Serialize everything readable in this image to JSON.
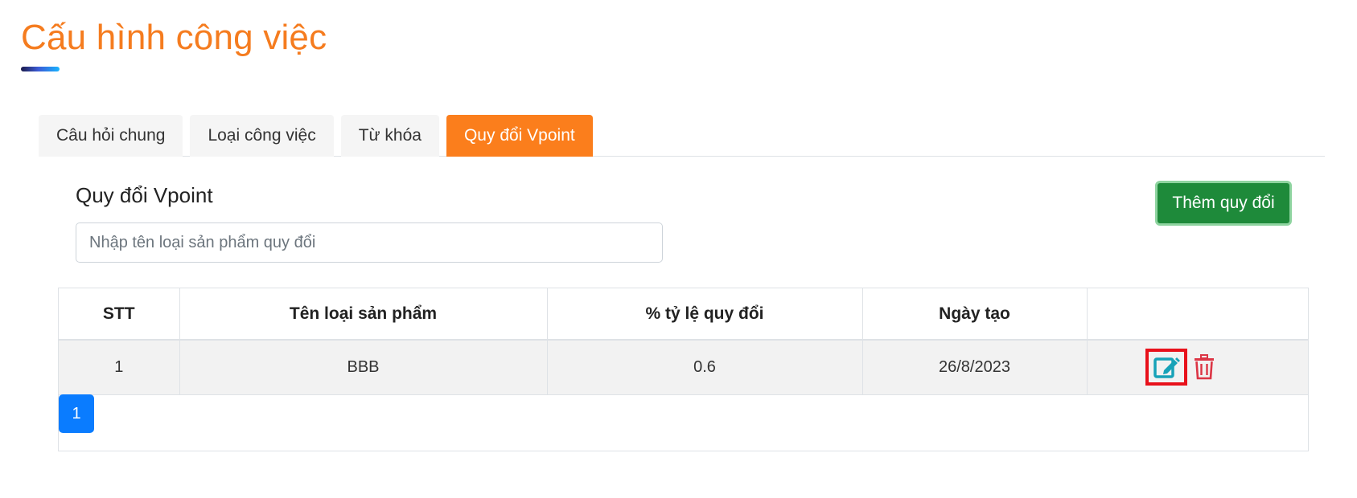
{
  "page": {
    "title": "Cấu hình công việc"
  },
  "tabs": [
    {
      "label": "Câu hỏi chung",
      "active": false
    },
    {
      "label": "Loại công việc",
      "active": false
    },
    {
      "label": "Từ khóa",
      "active": false
    },
    {
      "label": "Quy đổi Vpoint",
      "active": true
    }
  ],
  "section": {
    "title": "Quy đổi Vpoint",
    "add_button": "Thêm quy đổi",
    "search": {
      "value": "",
      "placeholder": "Nhập tên loại sản phẩm quy đổi"
    }
  },
  "table": {
    "headers": [
      "STT",
      "Tên loại sản phẩm",
      "% tỷ lệ quy đổi",
      "Ngày tạo",
      ""
    ],
    "rows": [
      {
        "stt": "1",
        "name": "BBB",
        "rate": "0.6",
        "date": "26/8/2023",
        "actions": [
          "edit-icon",
          "trash-icon"
        ]
      }
    ]
  },
  "pagination": {
    "current": "1"
  },
  "colors": {
    "title": "#f57c1f",
    "active_tab": "#fb7e1c",
    "add_button": "#1e8a3a",
    "edit_icon": "#17a2b8",
    "delete_icon": "#dc3545",
    "pagination": "#0a7cff",
    "highlight_box": "#e8111b"
  }
}
